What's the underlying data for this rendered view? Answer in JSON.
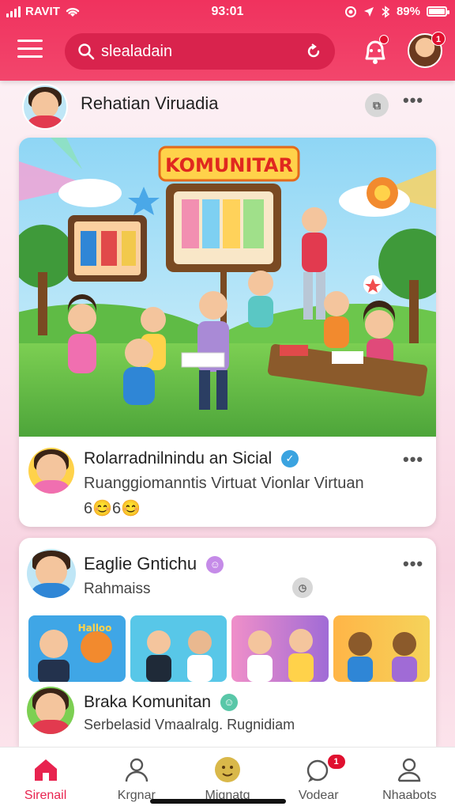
{
  "status_bar": {
    "carrier": "RAVIT",
    "time": "93:01",
    "battery": "89%",
    "battery_level": 0.89
  },
  "app_bar": {
    "search_value": "slealadain",
    "icons": [
      "menu-icon",
      "search-icon",
      "refresh-icon",
      "bell-icon",
      "avatar"
    ],
    "notification_badge": "",
    "avatar_badge": "1"
  },
  "post1": {
    "author": "Rehatian Viruadia",
    "hero_title": "KOMUNITAR",
    "caption_author": "Rolarradnilnindu an Sicial",
    "caption_text": "Ruanggiomanntis Virtuat Vionlar Virtuan",
    "reactions": "6😊6😊"
  },
  "post2": {
    "author": "Eaglie Gntichu",
    "subtitle": "Rahmaiss",
    "thumb_label": "Halloo",
    "comment_author": "Braka Komunitan",
    "comment_text": "Serbelasid Vmaalralg. Rugnidiam"
  },
  "nav": {
    "items": [
      {
        "label": "Sirenail",
        "icon": "home-icon",
        "active": true
      },
      {
        "label": "Krgnar",
        "icon": "user-icon",
        "active": false
      },
      {
        "label": "Mignatg",
        "icon": "emoji-icon",
        "active": false
      },
      {
        "label": "Vodear",
        "icon": "chat-icon",
        "active": false,
        "badge": "1"
      },
      {
        "label": "Nhaabots",
        "icon": "profile-icon",
        "active": false
      }
    ]
  },
  "colors": {
    "brand": "#f0325e",
    "brand_dark": "#d9234d",
    "active_nav": "#e8234f"
  }
}
